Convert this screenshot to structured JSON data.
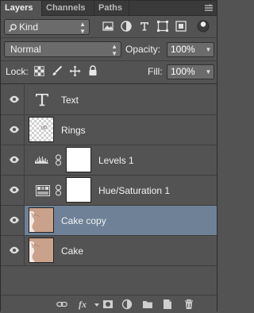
{
  "tabs": [
    {
      "label": "Layers",
      "active": true
    },
    {
      "label": "Channels",
      "active": false
    },
    {
      "label": "Paths",
      "active": false
    }
  ],
  "filter": {
    "kind_label": "Kind",
    "icons": [
      "pixel-filter-icon",
      "adjustment-filter-icon",
      "type-filter-icon",
      "shape-filter-icon",
      "smart-object-filter-icon",
      "filter-toggle-icon"
    ]
  },
  "blend": {
    "mode": "Normal",
    "opacity_label": "Opacity:",
    "opacity_value": "100%"
  },
  "lock": {
    "label": "Lock:",
    "fill_label": "Fill:",
    "fill_value": "100%"
  },
  "layers": [
    {
      "name": "Text",
      "type": "text",
      "selected": false
    },
    {
      "name": "Rings",
      "type": "pixel",
      "selected": false
    },
    {
      "name": "Levels 1",
      "type": "adjustment",
      "selected": false
    },
    {
      "name": "Hue/Saturation 1",
      "type": "adjustment",
      "selected": false
    },
    {
      "name": "Cake copy",
      "type": "pixel",
      "selected": true
    },
    {
      "name": "Cake",
      "type": "pixel",
      "selected": false
    }
  ],
  "colors": {
    "panel_bg": "#535353",
    "selected_row": "#6e8197",
    "tab_bar": "#3a3a3a"
  }
}
